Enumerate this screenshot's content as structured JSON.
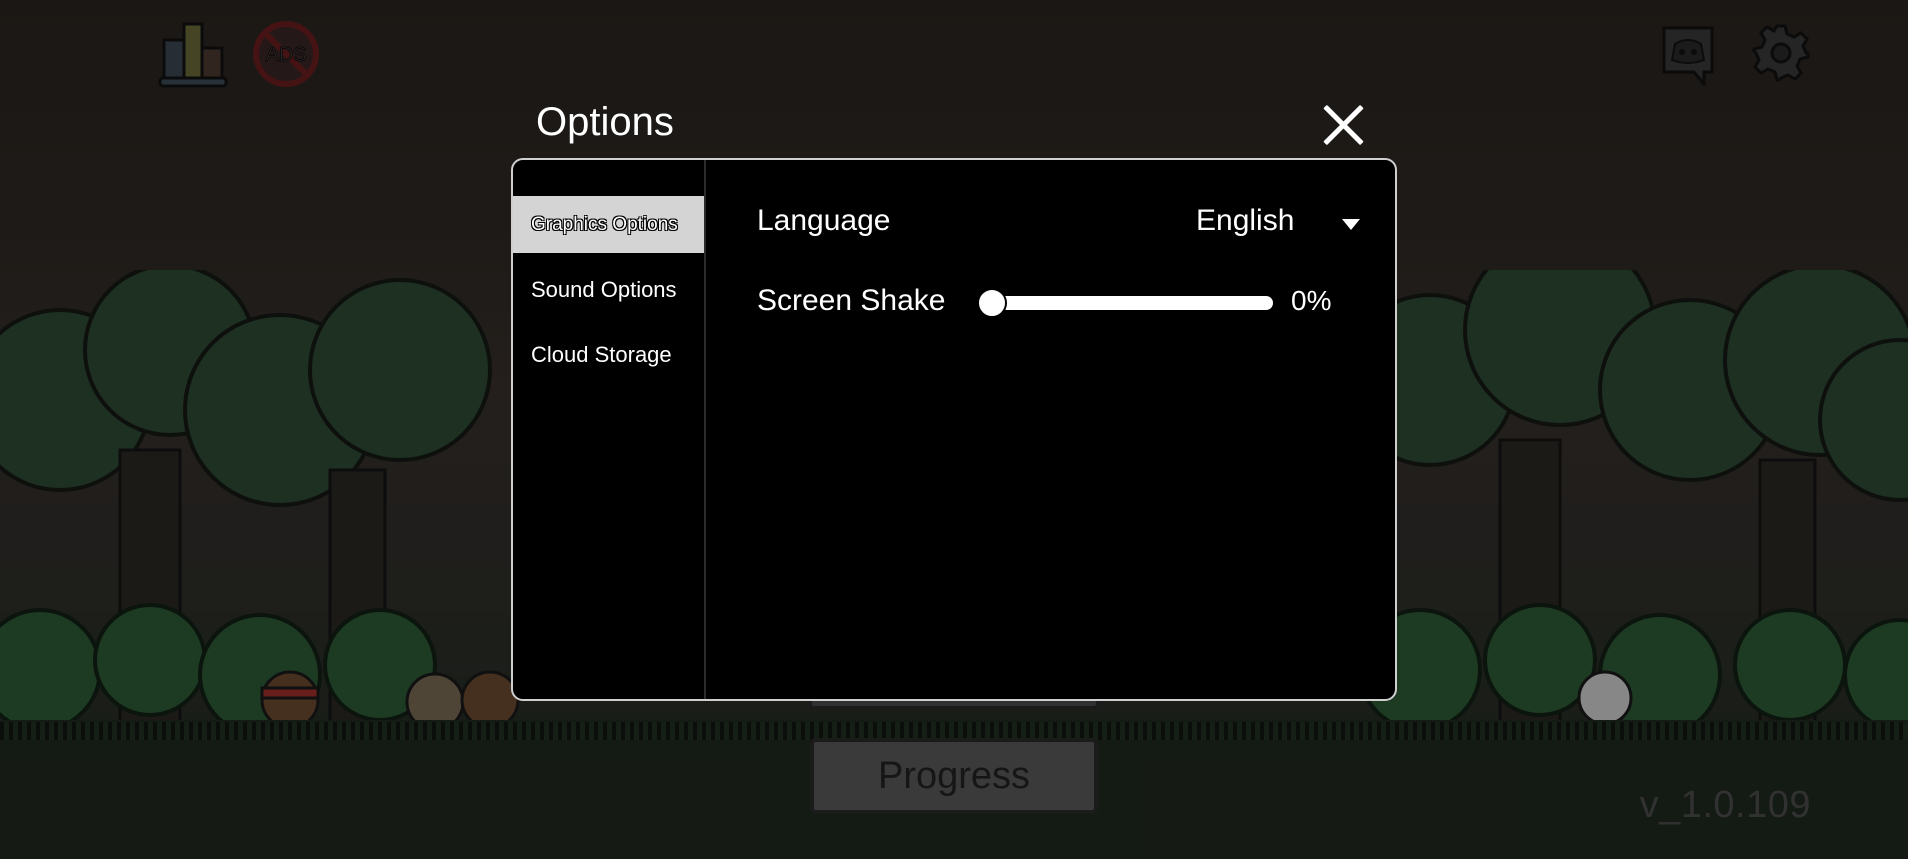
{
  "background": {
    "version_text": "v_1.0.109",
    "progress_button_label": "Progress"
  },
  "hud": {
    "left_icons": [
      "leaderboard-podium-icon",
      "no-ads-icon"
    ],
    "right_icons": [
      "discord-icon",
      "settings-gear-icon"
    ]
  },
  "dialog": {
    "title": "Options",
    "close_icon": "close-icon",
    "tabs": [
      {
        "label": "Graphics Options",
        "active": true
      },
      {
        "label": "Sound Options",
        "active": false
      },
      {
        "label": "Cloud Storage",
        "active": false
      }
    ],
    "language": {
      "label": "Language",
      "value": "English"
    },
    "screen_shake": {
      "label": "Screen Shake",
      "value": 0,
      "value_text": "0%"
    }
  }
}
